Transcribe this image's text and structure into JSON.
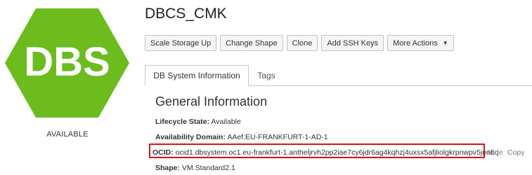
{
  "logo": {
    "text": "DBS",
    "fill": "#6cbc1e",
    "text_color": "#ffffff"
  },
  "status": {
    "label": "AVAILABLE"
  },
  "header": {
    "title": "DBCS_CMK"
  },
  "toolbar": {
    "scale_storage": "Scale Storage Up",
    "change_shape": "Change Shape",
    "clone": "Clone",
    "add_ssh_keys": "Add SSH Keys",
    "more_actions": "More Actions"
  },
  "tabs": [
    {
      "label": "DB System Information",
      "active": true
    },
    {
      "label": "Tags",
      "active": false
    }
  ],
  "general": {
    "heading": "General Information",
    "lifecycle_label": "Lifecycle State:",
    "lifecycle_value": "Available",
    "ad_label": "Availability Domain:",
    "ad_value": "AAef:EU-FRANKFURT-1-AD-1",
    "ocid_label": "OCID:",
    "ocid_value": "ocid1.dbsystem.oc1.eu-frankfurt-1.antheljrvh2pp2iae7cy6jdr6ag4kqhzj4uxsx5afjliolgkrpnwpv5jonbq",
    "hide_link": "Hide",
    "copy_link": "Copy",
    "shape_label": "Shape:",
    "shape_value": "VM.Standard2.1"
  },
  "highlight_color": "#e0101a"
}
